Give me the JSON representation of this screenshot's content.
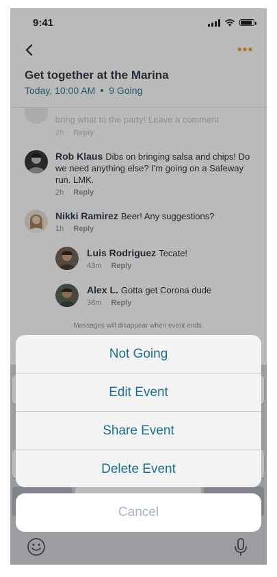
{
  "status_bar": {
    "time": "9:41"
  },
  "event": {
    "title": "Get together at the Marina",
    "date": "Today, 10:00 AM",
    "going": "9 Going"
  },
  "comments": [
    {
      "name": "",
      "text": "bring what to the party! Leave a comment",
      "time": "2h",
      "reply": "Reply"
    },
    {
      "name": "Rob Klaus",
      "text": "Dibs on bringing salsa and chips! Do we need anything else? I'm going on a Safeway run. LMK.",
      "time": "2h",
      "reply": "Reply"
    },
    {
      "name": "Nikki Ramirez",
      "text": "Beer! Any suggestions?",
      "time": "1h",
      "reply": "Reply"
    },
    {
      "name": "Luis Rodriguez",
      "text": "Tecate!",
      "time": "43m",
      "reply": "Reply"
    },
    {
      "name": "Alex L.",
      "text": "Gotta get Corona dude",
      "time": "38m",
      "reply": "Reply"
    }
  ],
  "notice": "Messages will disappear when event ends.",
  "action_sheet": {
    "options": [
      "Not Going",
      "Edit Event",
      "Share Event",
      "Delete Event"
    ],
    "cancel": "Cancel"
  },
  "colors": {
    "accent": "#1b6f8c",
    "more_dots": "#e0a020",
    "cancel_text": "#a8b3bd"
  },
  "icons": [
    "back-chevron-icon",
    "more-dots-icon",
    "emoji-icon",
    "microphone-icon",
    "signal-icon",
    "wifi-icon",
    "battery-icon"
  ]
}
